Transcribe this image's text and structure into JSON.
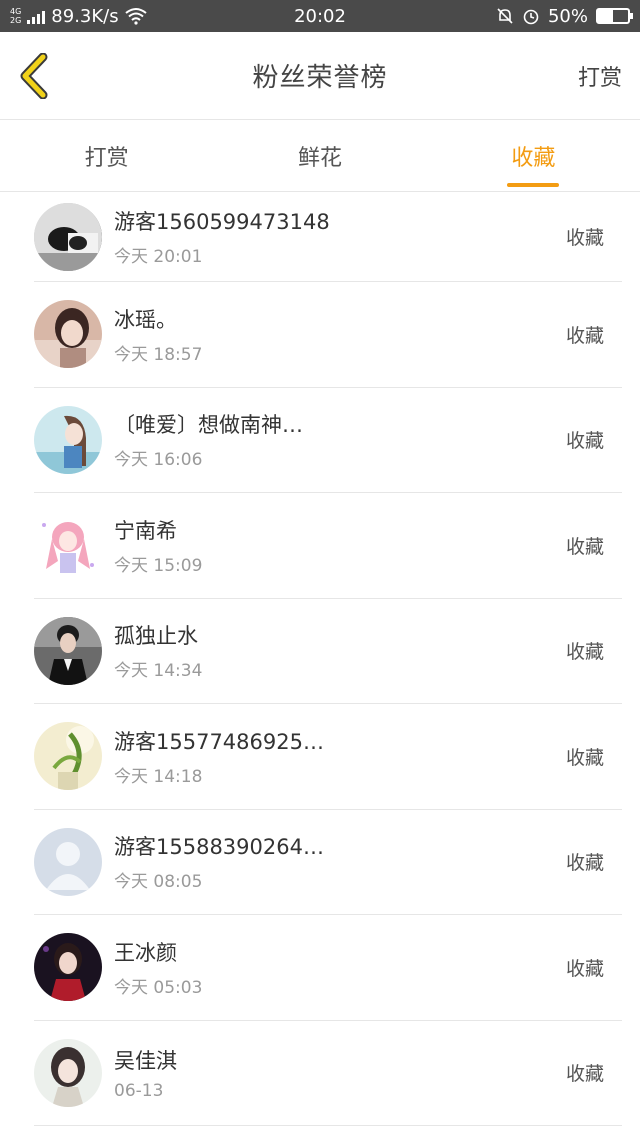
{
  "status_bar": {
    "net_top": "4G",
    "net_bottom": "2G",
    "speed": "89.3K/s",
    "time": "20:02",
    "battery_text": "50%",
    "battery_level": 0.5
  },
  "header": {
    "title": "粉丝荣誉榜",
    "action": "打赏"
  },
  "tabs": [
    {
      "label": "打赏",
      "active": false
    },
    {
      "label": "鲜花",
      "active": false
    },
    {
      "label": "收藏",
      "active": true
    }
  ],
  "colors": {
    "accent": "#f39c12",
    "back_icon": "#f1d21a"
  },
  "list": [
    {
      "name": "游客15605994731​48",
      "time": "今天 20:01",
      "action": "收藏",
      "avatar": "bw-photo"
    },
    {
      "name": "冰瑶。",
      "time": "今天 18:57",
      "action": "收藏",
      "avatar": "girl-photo"
    },
    {
      "name": "〔唯爱〕想做南神…",
      "time": "今天 16:06",
      "action": "收藏",
      "avatar": "anime-girl"
    },
    {
      "name": "宁南希",
      "time": "今天 15:09",
      "action": "收藏",
      "avatar": "pink-anime"
    },
    {
      "name": "孤独止水",
      "time": "今天 14:34",
      "action": "收藏",
      "avatar": "man-suit"
    },
    {
      "name": "游客15577486925…",
      "time": "今天 14:18",
      "action": "收藏",
      "avatar": "plant-photo"
    },
    {
      "name": "游客15588390264…",
      "time": "今天 08:05",
      "action": "收藏",
      "avatar": "default-user"
    },
    {
      "name": "王冰颜",
      "time": "今天 05:03",
      "action": "收藏",
      "avatar": "woman-dark"
    },
    {
      "name": "吴佳淇",
      "time": "06-13",
      "action": "收藏",
      "avatar": "woman-light"
    }
  ]
}
